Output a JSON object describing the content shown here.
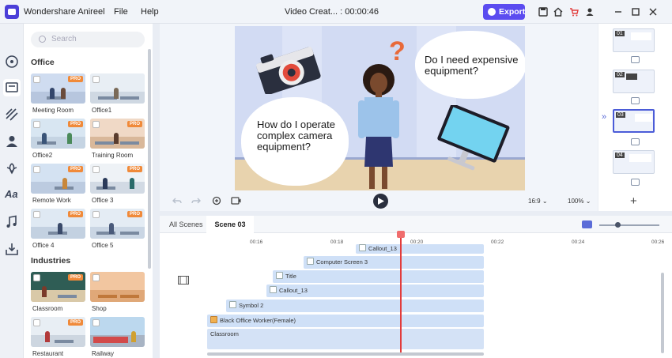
{
  "app": {
    "name": "Wondershare Anireel",
    "menu": [
      "File",
      "Help"
    ],
    "project_title": "Video Creat... : 00:00:46",
    "export_label": "Export"
  },
  "colors": {
    "accent": "#5b4cf0",
    "playhead": "#e23b3b",
    "pro_badge": "#f08a3a",
    "track": "#cfe0f7"
  },
  "library": {
    "search_placeholder": "Search",
    "sections": [
      {
        "title": "Office",
        "items": [
          {
            "label": "Meeting Room",
            "pro": "PRO"
          },
          {
            "label": "Office1"
          },
          {
            "label": "Office2",
            "pro": "PRO"
          },
          {
            "label": "Training Room",
            "pro": "PRO"
          },
          {
            "label": "Remote Work",
            "pro": "PRO"
          },
          {
            "label": "Office 3",
            "pro": "PRO"
          },
          {
            "label": "Office 4",
            "pro": "PRO"
          },
          {
            "label": "Office 5",
            "pro": "PRO"
          }
        ]
      },
      {
        "title": "Industries",
        "items": [
          {
            "label": "Classroom",
            "pro": "PRO"
          },
          {
            "label": "Shop"
          },
          {
            "label": "Restaurant",
            "pro": "PRO"
          },
          {
            "label": "Railway"
          }
        ]
      }
    ]
  },
  "preview": {
    "bubbles": [
      "Do I need expensive\nequipment?",
      "How do I operate\ncomplex camera\nequipment?"
    ],
    "aspect": "16:9",
    "zoom": "100%"
  },
  "scenes": {
    "thumbnails": [
      "01",
      "02",
      "03",
      "04"
    ],
    "selected": 2
  },
  "timeline": {
    "tabs": [
      "All Scenes",
      "Scene 03"
    ],
    "ticks": [
      "00:16",
      "00:18",
      "00:20",
      "00:22",
      "00:24",
      "00:26"
    ],
    "tracks": [
      "Callout_13",
      "Computer Screen 3",
      "Title",
      "Callout_13",
      "Symbol 2",
      "Black Office Worker(Female)",
      "Classroom"
    ]
  }
}
